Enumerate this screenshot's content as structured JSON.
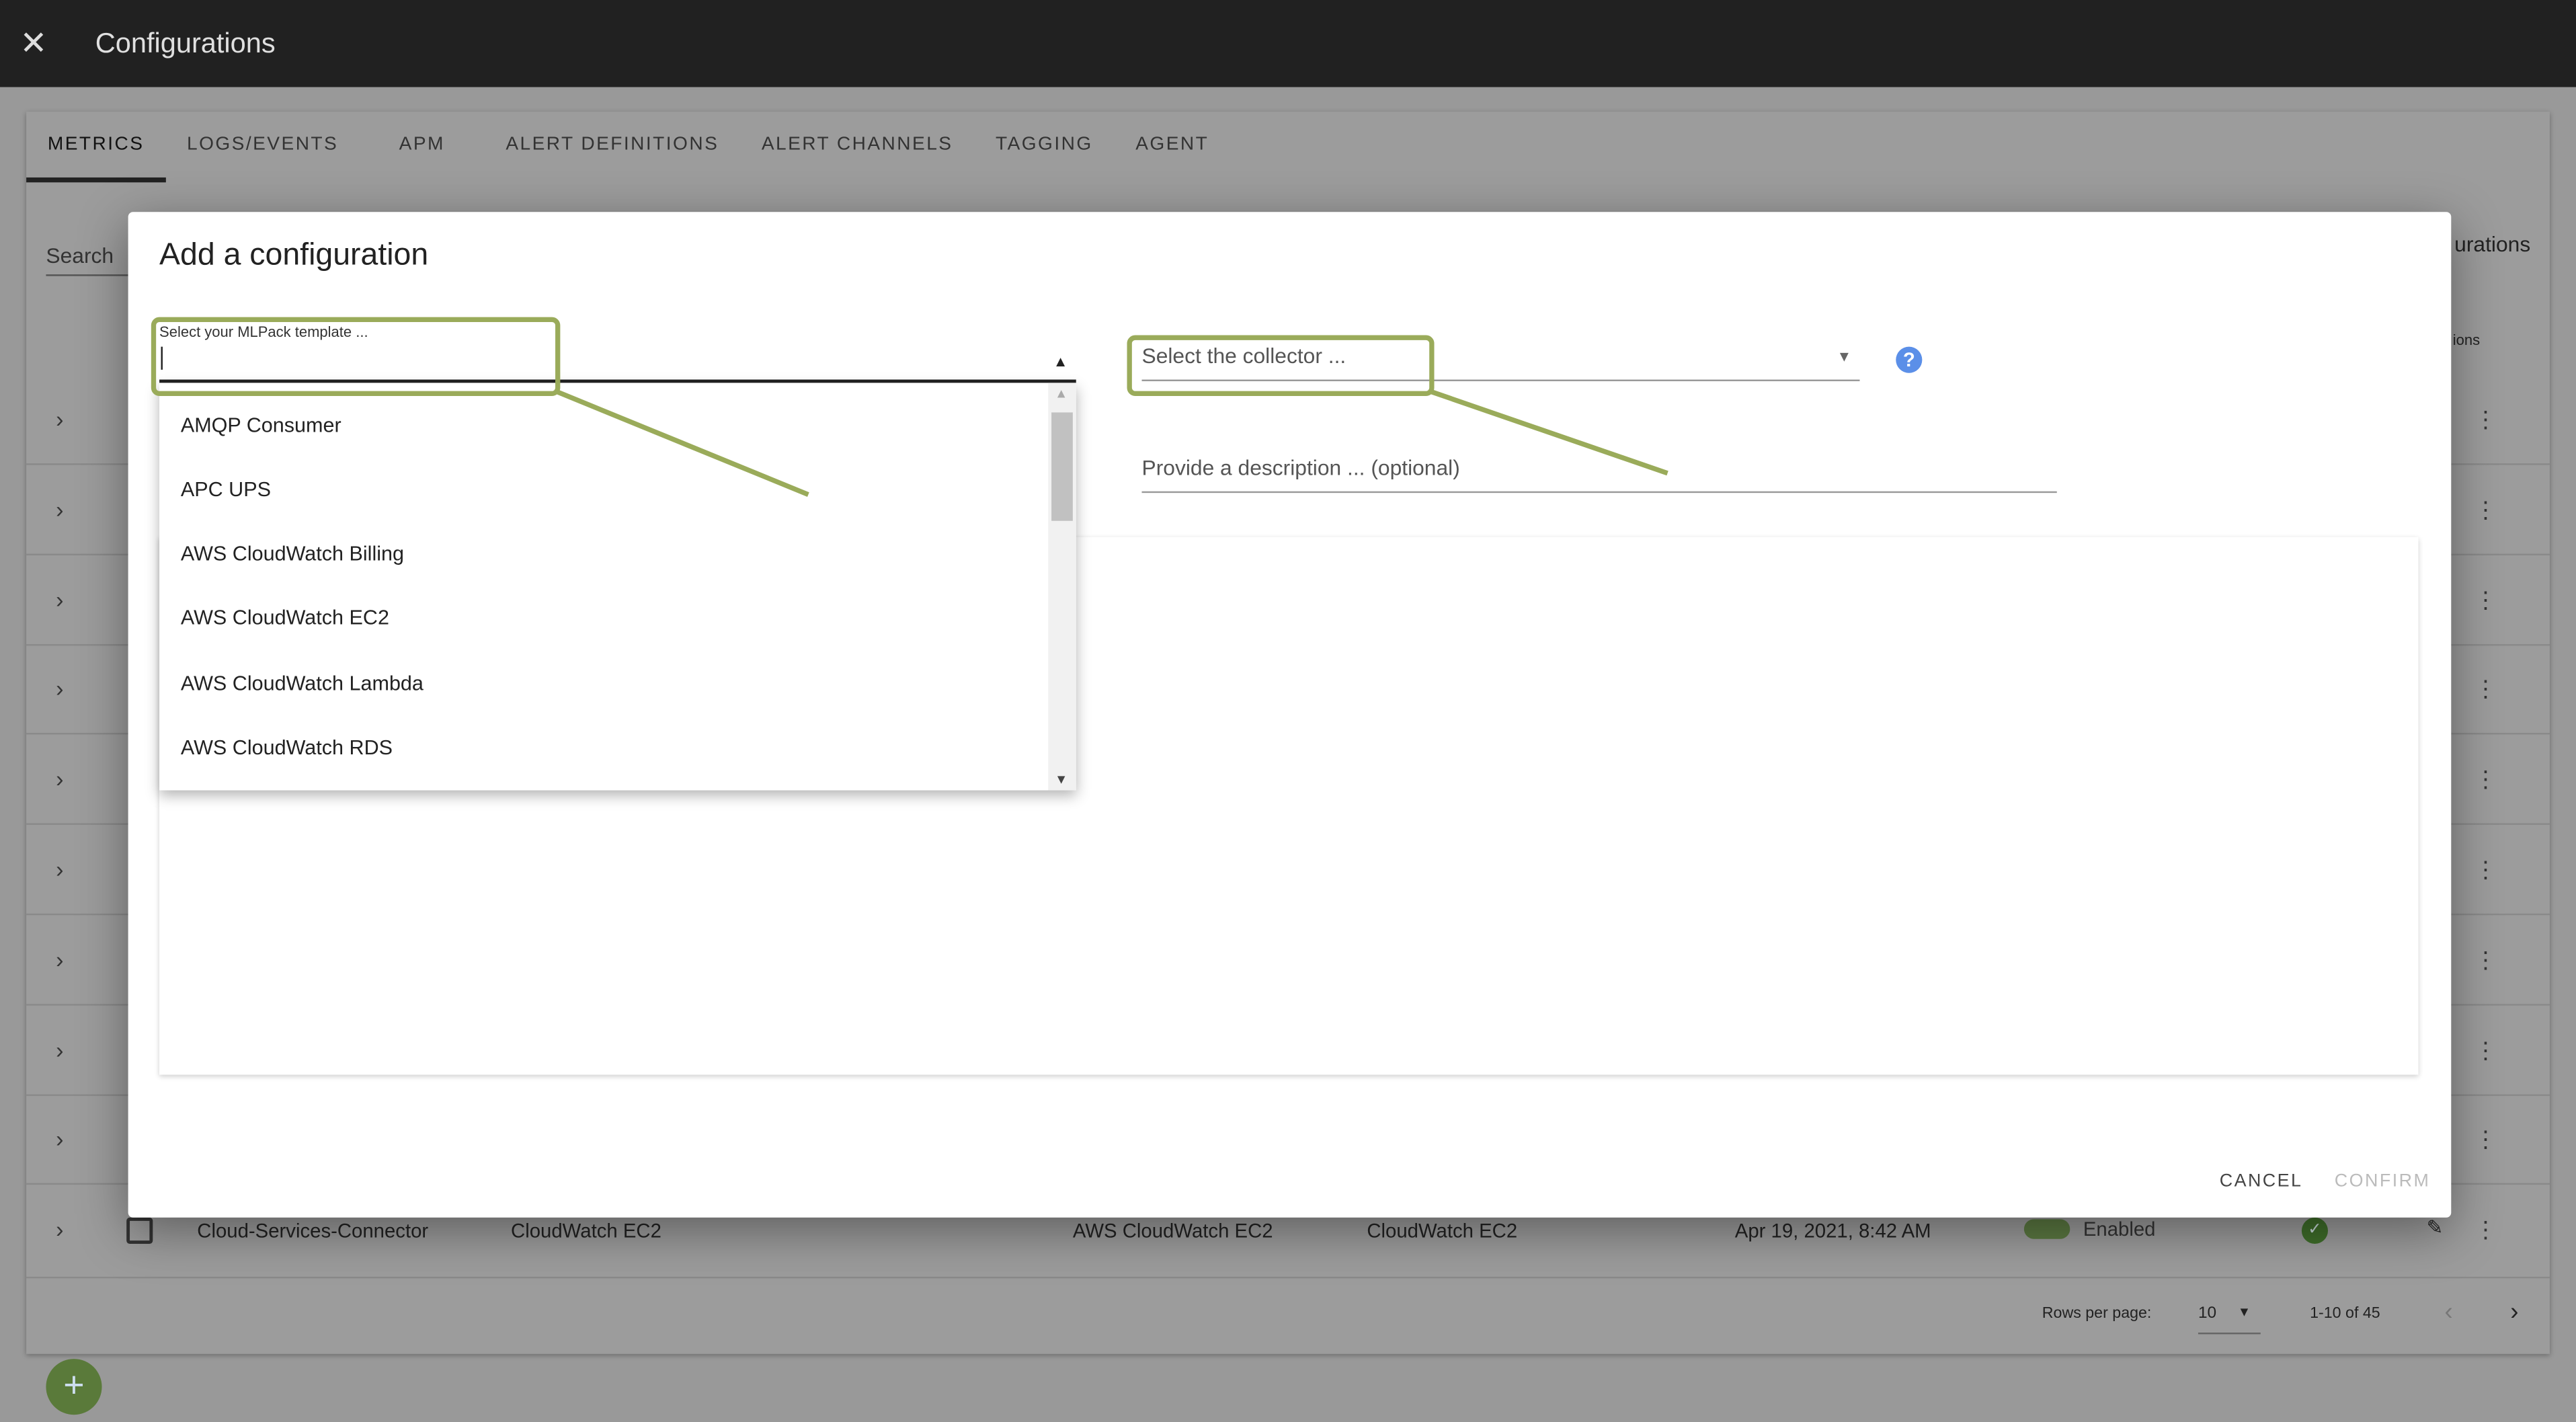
{
  "app": {
    "title": "Configurations",
    "close_icon": "close-icon"
  },
  "tabs": [
    "METRICS",
    "LOGS/EVENTS",
    "APM",
    "ALERT DEFINITIONS",
    "ALERT CHANNELS",
    "TAGGING",
    "AGENT"
  ],
  "background": {
    "search_label": "Search",
    "partial_header": "urations",
    "partial_col": "ions",
    "row": {
      "name": "Cloud-Services-Connector",
      "col2": "CloudWatch EC2",
      "col3": "AWS CloudWatch EC2",
      "col4": "CloudWatch EC2",
      "date": "Apr 19, 2021, 8:42 AM",
      "status": "Enabled"
    },
    "pagination": {
      "rows_label": "Rows per page:",
      "rows_value": "10",
      "range": "1-10 of 45"
    }
  },
  "dialog": {
    "title": "Add a configuration",
    "template_label": "Select your MLPack template ...",
    "collector_placeholder": "Select the collector ...",
    "description_placeholder": "Provide a description ... (optional)",
    "options": [
      "AMQP Consumer",
      "APC UPS",
      "AWS CloudWatch Billing",
      "AWS CloudWatch EC2",
      "AWS CloudWatch Lambda",
      "AWS CloudWatch RDS"
    ],
    "cancel": "CANCEL",
    "confirm": "CONFIRM"
  },
  "colors": {
    "callout": "#9aab5a",
    "help": "#5b8fe8",
    "fab": "#5a7a3a"
  }
}
